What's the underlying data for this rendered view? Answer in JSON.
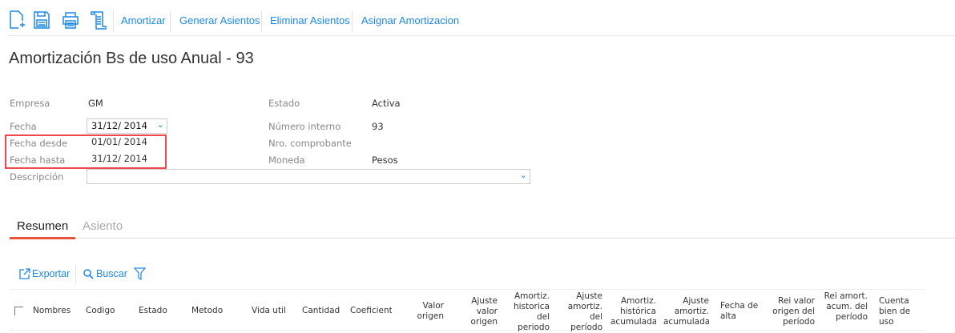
{
  "toolbar": {
    "icons": [
      "new-document-icon",
      "save-icon",
      "print-icon",
      "scroll-icon"
    ],
    "actions": [
      "Amortizar",
      "Generar Asientos",
      "Eliminar Asientos",
      "Asignar Amortizacion"
    ]
  },
  "page_title": "Amortización Bs de uso Anual - 93",
  "form": {
    "empresa_label": "Empresa",
    "empresa": "GM",
    "fecha_label": "Fecha",
    "fecha": "31/12/ 2014",
    "fecha_desde_label": "Fecha desde",
    "fecha_desde": "01/01/ 2014",
    "fecha_hasta_label": "Fecha hasta",
    "fecha_hasta": "31/12/ 2014",
    "descripcion_label": "Descripción",
    "descripcion": "",
    "estado_label": "Estado",
    "estado": "Activa",
    "numero_label": "Número interno",
    "numero": "93",
    "comprobante_label": "Nro. comprobante",
    "comprobante": "",
    "moneda_label": "Moneda",
    "moneda": "Pesos"
  },
  "tabs": [
    "Resumen",
    "Asiento"
  ],
  "grid_toolbar": {
    "export": "Exportar",
    "search": "Buscar"
  },
  "columns": [
    "Nombres",
    "Codigo",
    "Estado",
    "Metodo",
    "Vida util",
    "Cantidad",
    "Coeficiente",
    "Valor origen",
    "Ajuste valor origen",
    "Amortiz. historica del periodo",
    "Ajuste amortiz. del período",
    "Amortiz. histórica acumulada",
    "Ajuste amortiz. acumulada",
    "Fecha de alta",
    "Rei valor origen del período",
    "Rei amort. acum. del período",
    "Cuenta bien de uso"
  ],
  "colors": {
    "accent": "#1e88e5",
    "tab_underline": "#e8523a",
    "highlight": "#f0464d"
  }
}
